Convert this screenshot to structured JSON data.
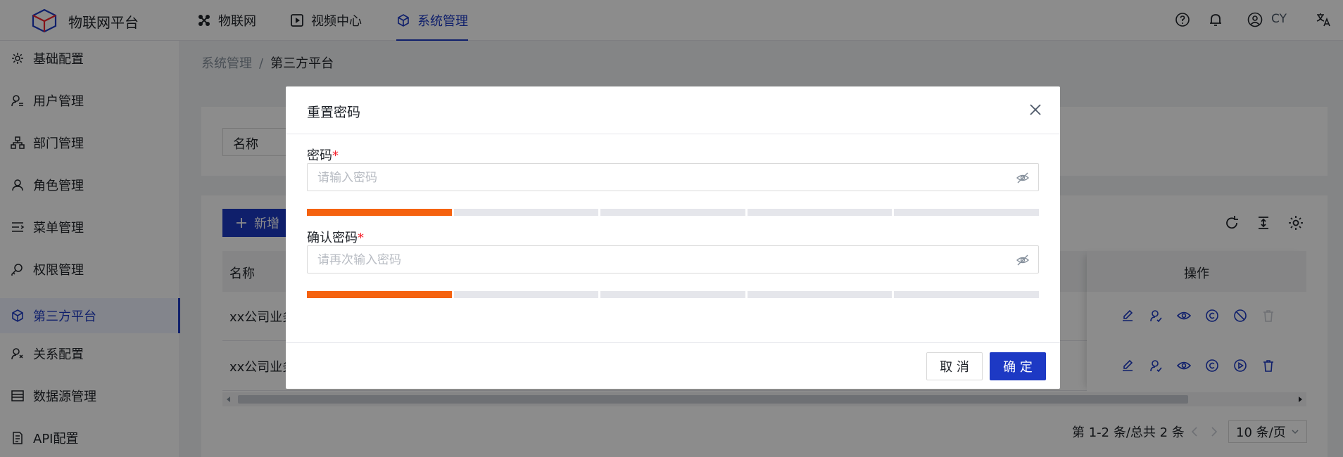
{
  "app": {
    "title": "物联网平台"
  },
  "topnav": {
    "items": [
      {
        "label": "物联网",
        "icon": "iot-icon"
      },
      {
        "label": "视频中心",
        "icon": "video-icon"
      },
      {
        "label": "系统管理",
        "icon": "cube-icon",
        "active": true
      }
    ],
    "user": "CY",
    "accent": "#1d39c4"
  },
  "sidebar": {
    "items": [
      {
        "label": "基础配置",
        "icon": "gear-icon"
      },
      {
        "label": "用户管理",
        "icon": "user-manage-icon"
      },
      {
        "label": "部门管理",
        "icon": "org-tree-icon"
      },
      {
        "label": "角色管理",
        "icon": "role-icon"
      },
      {
        "label": "菜单管理",
        "icon": "menu-list-icon"
      },
      {
        "label": "权限管理",
        "icon": "permission-icon"
      },
      {
        "label": "第三方平台",
        "icon": "cube-icon",
        "active": true
      },
      {
        "label": "关系配置",
        "icon": "relation-icon"
      },
      {
        "label": "数据源管理",
        "icon": "database-icon"
      },
      {
        "label": "API配置",
        "icon": "api-doc-icon"
      }
    ]
  },
  "breadcrumb": {
    "parent": "系统管理",
    "separator": "/",
    "current": "第三方平台"
  },
  "search": {
    "name_label": "名称"
  },
  "toolbar": {
    "add_label": "新增"
  },
  "table": {
    "columns": {
      "name": "名称",
      "operation": "操作"
    },
    "rows": [
      {
        "name": "xx公司业务"
      },
      {
        "name": "xx公司业务"
      }
    ]
  },
  "pagination": {
    "summary": "第 1-2 条/总共 2 条",
    "page_size": "10 条/页"
  },
  "modal": {
    "title": "重置密码",
    "password": {
      "label": "密码",
      "required_mark": "*",
      "placeholder": "请输入密码",
      "strength_level": 1,
      "strength_segments": 5
    },
    "confirm": {
      "label": "确认密码",
      "required_mark": "*",
      "placeholder": "请再次输入密码",
      "strength_level": 1,
      "strength_segments": 5
    },
    "cancel_label": "取 消",
    "ok_label": "确 定",
    "strength_color": "#f5620f"
  }
}
